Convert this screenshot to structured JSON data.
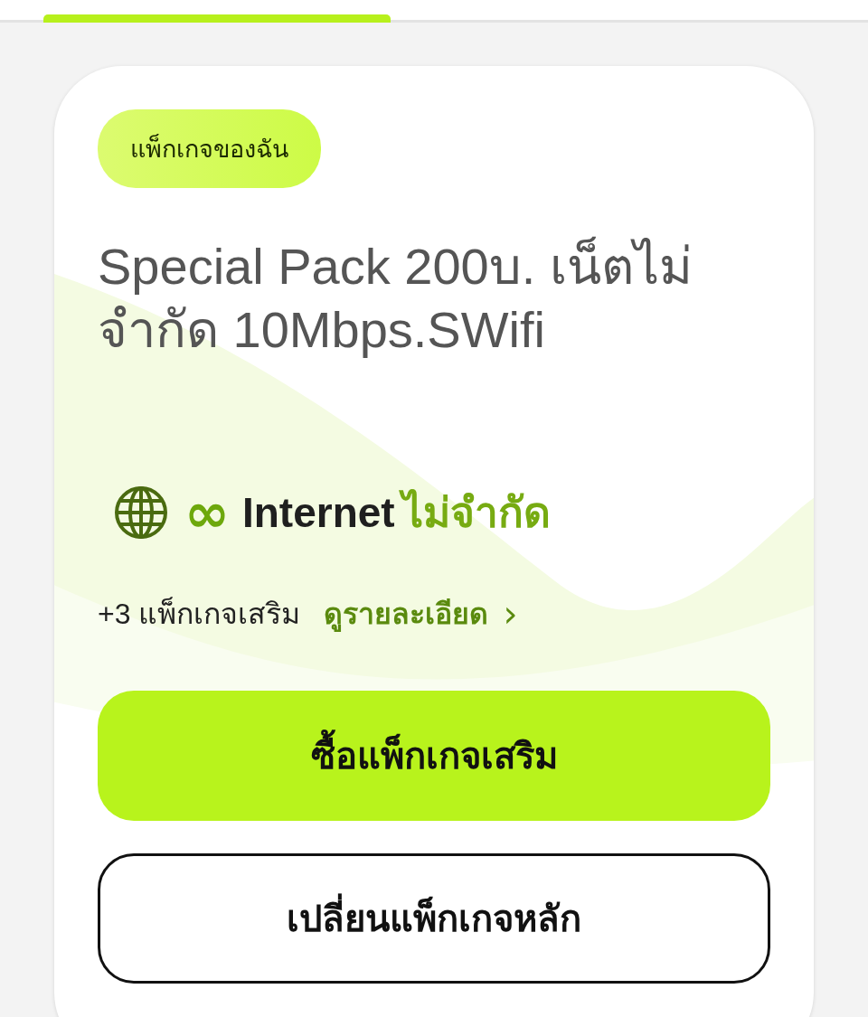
{
  "card": {
    "badge": "แพ็กเกจของฉัน",
    "title": "Special Pack 200บ. เน็ตไม่จำกัด 10Mbps.SWifi",
    "feature": {
      "symbol": "∞",
      "label": "Internet",
      "highlight": "ไม่จำกัด"
    },
    "extras": {
      "text": "+3 แพ็กเกจเสริม",
      "link": "ดูรายละเอียด",
      "chevron": "›"
    },
    "buttons": [
      {
        "label": "ซื้อแพ็กเกจเสริม",
        "kind": "primary"
      },
      {
        "label": "เปลี่ยนแพ็กเกจหลัก",
        "kind": "outline"
      }
    ]
  }
}
